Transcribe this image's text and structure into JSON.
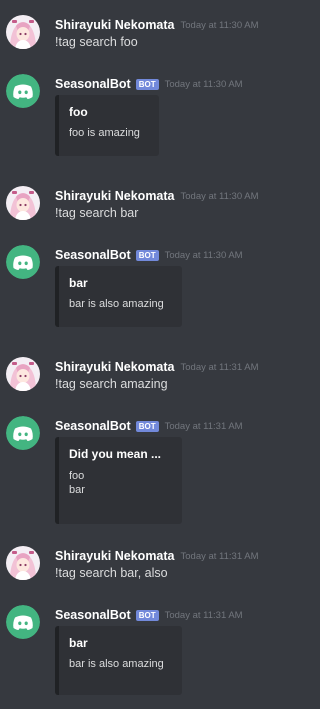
{
  "messages": [
    {
      "author": "Shirayuki Nekomata",
      "avatar": "anime-avatar",
      "timestamp": "Today at 11:30 AM",
      "content": "!tag search foo"
    },
    {
      "author": "SeasonalBot",
      "badge": "BOT",
      "avatar": "discord-logo-icon",
      "timestamp": "Today at 11:30 AM",
      "embed": {
        "title": "foo",
        "lines": [
          "foo is amazing"
        ]
      }
    },
    {
      "author": "Shirayuki Nekomata",
      "avatar": "anime-avatar",
      "timestamp": "Today at 11:30 AM",
      "content": "!tag search bar"
    },
    {
      "author": "SeasonalBot",
      "badge": "BOT",
      "avatar": "discord-logo-icon",
      "timestamp": "Today at 11:30 AM",
      "embed": {
        "title": "bar",
        "lines": [
          "bar is also amazing"
        ]
      }
    },
    {
      "author": "Shirayuki Nekomata",
      "avatar": "anime-avatar",
      "timestamp": "Today at 11:31 AM",
      "content": "!tag search amazing"
    },
    {
      "author": "SeasonalBot",
      "badge": "BOT",
      "avatar": "discord-logo-icon",
      "timestamp": "Today at 11:31 AM",
      "embed": {
        "title": "Did you mean ...",
        "lines": [
          "foo",
          "bar"
        ]
      }
    },
    {
      "author": "Shirayuki Nekomata",
      "avatar": "anime-avatar",
      "timestamp": "Today at 11:31 AM",
      "content": "!tag search bar, also"
    },
    {
      "author": "SeasonalBot",
      "badge": "BOT",
      "avatar": "discord-logo-icon",
      "timestamp": "Today at 11:31 AM",
      "embed": {
        "title": "bar",
        "lines": [
          "bar is also amazing"
        ]
      }
    }
  ],
  "colors": {
    "background": "#36393f",
    "embed_background": "#2f3136",
    "embed_border": "#202225",
    "bot_badge": "#7289da",
    "discord_avatar": "#43b581",
    "username": "#ffffff",
    "timestamp": "#72767d",
    "text": "#dcddde"
  }
}
